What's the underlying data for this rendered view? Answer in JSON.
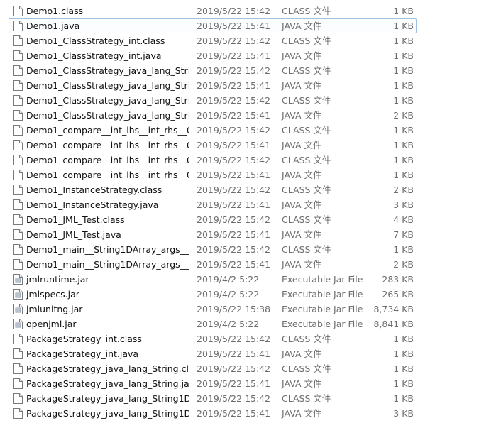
{
  "files": [
    {
      "name": "Demo1.class",
      "date": "2019/5/22 15:42",
      "type": "CLASS 文件",
      "size": "1 KB",
      "icon": "file-icon"
    },
    {
      "name": "Demo1.java",
      "date": "2019/5/22 15:41",
      "type": "JAVA 文件",
      "size": "1 KB",
      "icon": "file-icon"
    },
    {
      "name": "Demo1_ClassStrategy_int.class",
      "date": "2019/5/22 15:42",
      "type": "CLASS 文件",
      "size": "1 KB",
      "icon": "file-icon"
    },
    {
      "name": "Demo1_ClassStrategy_int.java",
      "date": "2019/5/22 15:41",
      "type": "JAVA 文件",
      "size": "1 KB",
      "icon": "file-icon"
    },
    {
      "name": "Demo1_ClassStrategy_java_lang_Strin...",
      "date": "2019/5/22 15:42",
      "type": "CLASS 文件",
      "size": "1 KB",
      "icon": "file-icon"
    },
    {
      "name": "Demo1_ClassStrategy_java_lang_Strin...",
      "date": "2019/5/22 15:41",
      "type": "JAVA 文件",
      "size": "1 KB",
      "icon": "file-icon"
    },
    {
      "name": "Demo1_ClassStrategy_java_lang_Strin...",
      "date": "2019/5/22 15:42",
      "type": "CLASS 文件",
      "size": "1 KB",
      "icon": "file-icon"
    },
    {
      "name": "Demo1_ClassStrategy_java_lang_Strin...",
      "date": "2019/5/22 15:41",
      "type": "JAVA 文件",
      "size": "2 KB",
      "icon": "file-icon"
    },
    {
      "name": "Demo1_compare__int_lhs__int_rhs__0_...",
      "date": "2019/5/22 15:42",
      "type": "CLASS 文件",
      "size": "1 KB",
      "icon": "file-icon"
    },
    {
      "name": "Demo1_compare__int_lhs__int_rhs__0_...",
      "date": "2019/5/22 15:41",
      "type": "JAVA 文件",
      "size": "1 KB",
      "icon": "file-icon"
    },
    {
      "name": "Demo1_compare__int_lhs__int_rhs__0_...",
      "date": "2019/5/22 15:42",
      "type": "CLASS 文件",
      "size": "1 KB",
      "icon": "file-icon"
    },
    {
      "name": "Demo1_compare__int_lhs__int_rhs__0_...",
      "date": "2019/5/22 15:41",
      "type": "JAVA 文件",
      "size": "1 KB",
      "icon": "file-icon"
    },
    {
      "name": "Demo1_InstanceStrategy.class",
      "date": "2019/5/22 15:42",
      "type": "CLASS 文件",
      "size": "2 KB",
      "icon": "file-icon"
    },
    {
      "name": "Demo1_InstanceStrategy.java",
      "date": "2019/5/22 15:41",
      "type": "JAVA 文件",
      "size": "3 KB",
      "icon": "file-icon"
    },
    {
      "name": "Demo1_JML_Test.class",
      "date": "2019/5/22 15:42",
      "type": "CLASS 文件",
      "size": "4 KB",
      "icon": "file-icon"
    },
    {
      "name": "Demo1_JML_Test.java",
      "date": "2019/5/22 15:41",
      "type": "JAVA 文件",
      "size": "7 KB",
      "icon": "file-icon"
    },
    {
      "name": "Demo1_main__String1DArray_args__1...",
      "date": "2019/5/22 15:42",
      "type": "CLASS 文件",
      "size": "1 KB",
      "icon": "file-icon"
    },
    {
      "name": "Demo1_main__String1DArray_args__1...",
      "date": "2019/5/22 15:41",
      "type": "JAVA 文件",
      "size": "2 KB",
      "icon": "file-icon"
    },
    {
      "name": "jmlruntime.jar",
      "date": "2019/4/2 5:22",
      "type": "Executable Jar File",
      "size": "283 KB",
      "icon": "jar-icon"
    },
    {
      "name": "jmlspecs.jar",
      "date": "2019/4/2 5:22",
      "type": "Executable Jar File",
      "size": "265 KB",
      "icon": "jar-icon"
    },
    {
      "name": "jmlunitng.jar",
      "date": "2019/5/22 15:38",
      "type": "Executable Jar File",
      "size": "8,734 KB",
      "icon": "jar-icon"
    },
    {
      "name": "openjml.jar",
      "date": "2019/4/2 5:22",
      "type": "Executable Jar File",
      "size": "8,841 KB",
      "icon": "jar-icon"
    },
    {
      "name": "PackageStrategy_int.class",
      "date": "2019/5/22 15:42",
      "type": "CLASS 文件",
      "size": "1 KB",
      "icon": "file-icon"
    },
    {
      "name": "PackageStrategy_int.java",
      "date": "2019/5/22 15:41",
      "type": "JAVA 文件",
      "size": "1 KB",
      "icon": "file-icon"
    },
    {
      "name": "PackageStrategy_java_lang_String.class",
      "date": "2019/5/22 15:42",
      "type": "CLASS 文件",
      "size": "1 KB",
      "icon": "file-icon"
    },
    {
      "name": "PackageStrategy_java_lang_String.java",
      "date": "2019/5/22 15:41",
      "type": "JAVA 文件",
      "size": "1 KB",
      "icon": "file-icon"
    },
    {
      "name": "PackageStrategy_java_lang_String1D...",
      "date": "2019/5/22 15:42",
      "type": "CLASS 文件",
      "size": "1 KB",
      "icon": "file-icon"
    },
    {
      "name": "PackageStrategy_java_lang_String1D...",
      "date": "2019/5/22 15:41",
      "type": "JAVA 文件",
      "size": "3 KB",
      "icon": "file-icon"
    }
  ],
  "focused_index": 1
}
